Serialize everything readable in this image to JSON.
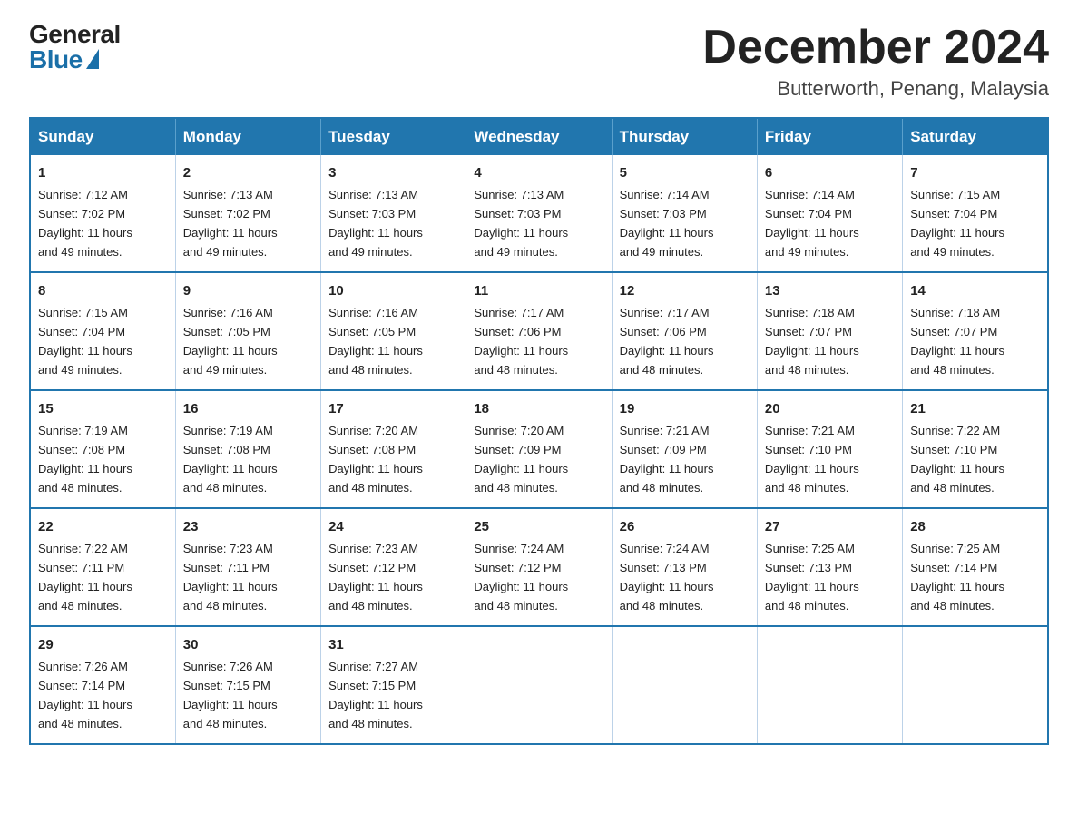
{
  "logo": {
    "general": "General",
    "blue": "Blue"
  },
  "header": {
    "month": "December 2024",
    "location": "Butterworth, Penang, Malaysia"
  },
  "days_of_week": [
    "Sunday",
    "Monday",
    "Tuesday",
    "Wednesday",
    "Thursday",
    "Friday",
    "Saturday"
  ],
  "weeks": [
    [
      {
        "day": "1",
        "sunrise": "7:12 AM",
        "sunset": "7:02 PM",
        "daylight": "11 hours and 49 minutes."
      },
      {
        "day": "2",
        "sunrise": "7:13 AM",
        "sunset": "7:02 PM",
        "daylight": "11 hours and 49 minutes."
      },
      {
        "day": "3",
        "sunrise": "7:13 AM",
        "sunset": "7:03 PM",
        "daylight": "11 hours and 49 minutes."
      },
      {
        "day": "4",
        "sunrise": "7:13 AM",
        "sunset": "7:03 PM",
        "daylight": "11 hours and 49 minutes."
      },
      {
        "day": "5",
        "sunrise": "7:14 AM",
        "sunset": "7:03 PM",
        "daylight": "11 hours and 49 minutes."
      },
      {
        "day": "6",
        "sunrise": "7:14 AM",
        "sunset": "7:04 PM",
        "daylight": "11 hours and 49 minutes."
      },
      {
        "day": "7",
        "sunrise": "7:15 AM",
        "sunset": "7:04 PM",
        "daylight": "11 hours and 49 minutes."
      }
    ],
    [
      {
        "day": "8",
        "sunrise": "7:15 AM",
        "sunset": "7:04 PM",
        "daylight": "11 hours and 49 minutes."
      },
      {
        "day": "9",
        "sunrise": "7:16 AM",
        "sunset": "7:05 PM",
        "daylight": "11 hours and 49 minutes."
      },
      {
        "day": "10",
        "sunrise": "7:16 AM",
        "sunset": "7:05 PM",
        "daylight": "11 hours and 48 minutes."
      },
      {
        "day": "11",
        "sunrise": "7:17 AM",
        "sunset": "7:06 PM",
        "daylight": "11 hours and 48 minutes."
      },
      {
        "day": "12",
        "sunrise": "7:17 AM",
        "sunset": "7:06 PM",
        "daylight": "11 hours and 48 minutes."
      },
      {
        "day": "13",
        "sunrise": "7:18 AM",
        "sunset": "7:07 PM",
        "daylight": "11 hours and 48 minutes."
      },
      {
        "day": "14",
        "sunrise": "7:18 AM",
        "sunset": "7:07 PM",
        "daylight": "11 hours and 48 minutes."
      }
    ],
    [
      {
        "day": "15",
        "sunrise": "7:19 AM",
        "sunset": "7:08 PM",
        "daylight": "11 hours and 48 minutes."
      },
      {
        "day": "16",
        "sunrise": "7:19 AM",
        "sunset": "7:08 PM",
        "daylight": "11 hours and 48 minutes."
      },
      {
        "day": "17",
        "sunrise": "7:20 AM",
        "sunset": "7:08 PM",
        "daylight": "11 hours and 48 minutes."
      },
      {
        "day": "18",
        "sunrise": "7:20 AM",
        "sunset": "7:09 PM",
        "daylight": "11 hours and 48 minutes."
      },
      {
        "day": "19",
        "sunrise": "7:21 AM",
        "sunset": "7:09 PM",
        "daylight": "11 hours and 48 minutes."
      },
      {
        "day": "20",
        "sunrise": "7:21 AM",
        "sunset": "7:10 PM",
        "daylight": "11 hours and 48 minutes."
      },
      {
        "day": "21",
        "sunrise": "7:22 AM",
        "sunset": "7:10 PM",
        "daylight": "11 hours and 48 minutes."
      }
    ],
    [
      {
        "day": "22",
        "sunrise": "7:22 AM",
        "sunset": "7:11 PM",
        "daylight": "11 hours and 48 minutes."
      },
      {
        "day": "23",
        "sunrise": "7:23 AM",
        "sunset": "7:11 PM",
        "daylight": "11 hours and 48 minutes."
      },
      {
        "day": "24",
        "sunrise": "7:23 AM",
        "sunset": "7:12 PM",
        "daylight": "11 hours and 48 minutes."
      },
      {
        "day": "25",
        "sunrise": "7:24 AM",
        "sunset": "7:12 PM",
        "daylight": "11 hours and 48 minutes."
      },
      {
        "day": "26",
        "sunrise": "7:24 AM",
        "sunset": "7:13 PM",
        "daylight": "11 hours and 48 minutes."
      },
      {
        "day": "27",
        "sunrise": "7:25 AM",
        "sunset": "7:13 PM",
        "daylight": "11 hours and 48 minutes."
      },
      {
        "day": "28",
        "sunrise": "7:25 AM",
        "sunset": "7:14 PM",
        "daylight": "11 hours and 48 minutes."
      }
    ],
    [
      {
        "day": "29",
        "sunrise": "7:26 AM",
        "sunset": "7:14 PM",
        "daylight": "11 hours and 48 minutes."
      },
      {
        "day": "30",
        "sunrise": "7:26 AM",
        "sunset": "7:15 PM",
        "daylight": "11 hours and 48 minutes."
      },
      {
        "day": "31",
        "sunrise": "7:27 AM",
        "sunset": "7:15 PM",
        "daylight": "11 hours and 48 minutes."
      },
      null,
      null,
      null,
      null
    ]
  ],
  "labels": {
    "sunrise": "Sunrise:",
    "sunset": "Sunset:",
    "daylight": "Daylight:"
  }
}
